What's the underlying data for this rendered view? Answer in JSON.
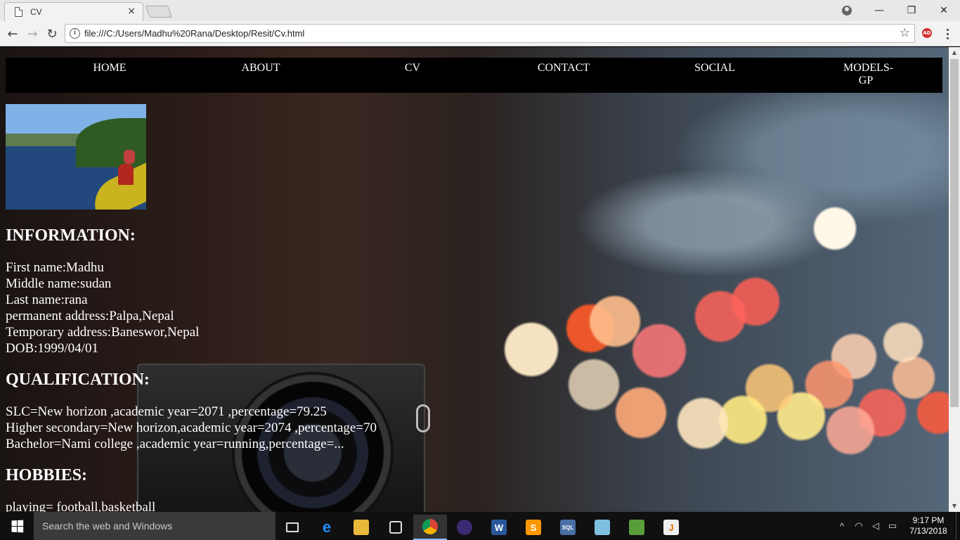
{
  "browser": {
    "tab_title": "CV",
    "tab_close": "×",
    "url": "file:///C:/Users/Madhu%20Rana/Desktop/Resit/Cv.html",
    "extension_badge": "AD",
    "window_minimize": "—",
    "window_restore": "❐",
    "window_close": "✕",
    "back": "←",
    "forward": "→",
    "reload": "↻",
    "info": "i",
    "bookmark": "☆"
  },
  "page": {
    "nav": [
      "HOME",
      "ABOUT",
      "CV",
      "CONTACT",
      "SOCIAL",
      "MODELS-GP"
    ],
    "information_heading": "INFORMATION:",
    "information": [
      "First name:Madhu",
      "Middle name:sudan",
      "Last name:rana",
      "permanent address:Palpa,Nepal",
      "Temporary address:Baneswor,Nepal",
      "DOB:1999/04/01"
    ],
    "qualification_heading": "QUALIFICATION:",
    "qualification": [
      "SLC=New horizon ,academic year=2071 ,percentage=79.25",
      "Higher secondary=New horizon,academic year=2074 ,percentage=70",
      "Bachelor=Nami college ,academic year=running,percentage=..."
    ],
    "hobbies_heading": "HOBBIES:",
    "hobbies": [
      "playing= football,basketball"
    ]
  },
  "taskbar": {
    "search_placeholder": "Search the web and Windows",
    "apps": [
      "task-view",
      "edge",
      "file-explorer",
      "store",
      "chrome",
      "eclipse",
      "word",
      "sublime-text",
      "sql-tool",
      "notepad-plus",
      "chart-app",
      "java"
    ],
    "time": "9:17 PM",
    "date": "7/13/2018",
    "tray_chevron": "^"
  },
  "icons": {
    "tab": "document-icon",
    "profile": "profile-icon",
    "menu": "kebab-menu-icon"
  }
}
